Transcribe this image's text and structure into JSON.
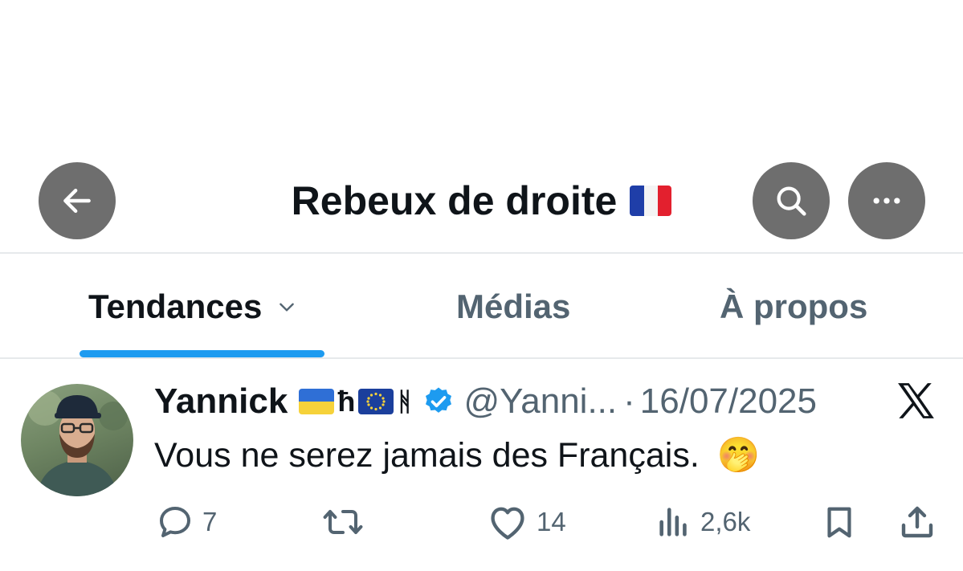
{
  "header": {
    "title": "Rebeux de droite",
    "title_flag_icon": "france-flag-icon",
    "back_icon": "arrow-left-icon",
    "search_icon": "search-icon",
    "more_icon": "more-horizontal-icon",
    "button_color": "#6e6e6e"
  },
  "tabs": [
    {
      "label": "Tendances",
      "active": true,
      "icon": "chevron-down-icon"
    },
    {
      "label": "Médias",
      "active": false
    },
    {
      "label": "À propos",
      "active": false
    }
  ],
  "tab_indicator_color": "#1d9bf0",
  "tweet": {
    "name": "Yannick",
    "name_glyph_1": "ћ",
    "name_glyph_2": "ᚻ",
    "name_icons": [
      "ukraine-flag-icon",
      "eu-flag-icon"
    ],
    "verified_icon": "verified-badge-icon",
    "handle": "@Yanni...",
    "separator": "·",
    "date": "16/07/2025",
    "platform_icon": "x-logo-icon",
    "text": "Vous ne serez jamais des Français.",
    "text_emoji": "🤭",
    "actions": {
      "reply": {
        "icon": "reply-icon",
        "count": "7"
      },
      "retweet": {
        "icon": "retweet-icon",
        "count": ""
      },
      "like": {
        "icon": "heart-icon",
        "count": "14"
      },
      "views": {
        "icon": "views-icon",
        "count": "2,6k"
      },
      "bookmark": {
        "icon": "bookmark-icon"
      },
      "share": {
        "icon": "share-icon"
      }
    },
    "verified_color": "#1d9bf0"
  }
}
